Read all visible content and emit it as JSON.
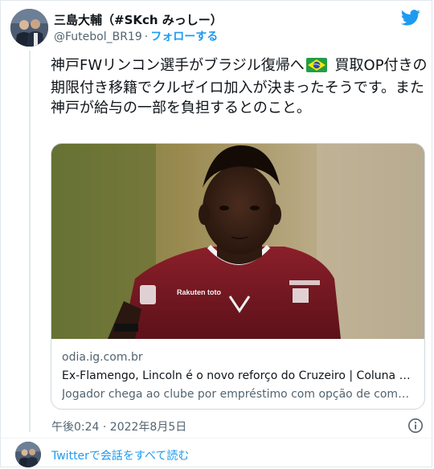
{
  "author": {
    "name": "三島大輔（#SKch みっしー）",
    "handle": "@Futebol_BR19",
    "separator": "·",
    "follow_label": "フォローする"
  },
  "tweet": {
    "text_before_flag": "神戸FWリンコン選手がブラジル復帰へ",
    "text_after_flag": "買取OP付きの期限付き移籍でクルゼイロ加入が決まったそうです。また神戸が給与の一部を負担するとのこと。"
  },
  "card": {
    "domain": "odia.ig.com.br",
    "title": "Ex-Flamengo, Lincoln é o novo reforço do Cruzeiro | Coluna do ...",
    "description": "Jogador chega ao clube por empréstimo com opção de compra",
    "jersey_sponsor": "Rakuten toto"
  },
  "timestamp": "午後0:24 · 2022年8月5日",
  "read_more": "Twitterで会話をすべて読む",
  "colors": {
    "accent": "#1d9bf0",
    "text": "#0f1419",
    "secondary": "#536471",
    "jersey": "#7a1a22"
  },
  "icons": {
    "brand": "twitter-bird-icon",
    "info": "info-icon",
    "flag": "brazil-flag-icon"
  }
}
